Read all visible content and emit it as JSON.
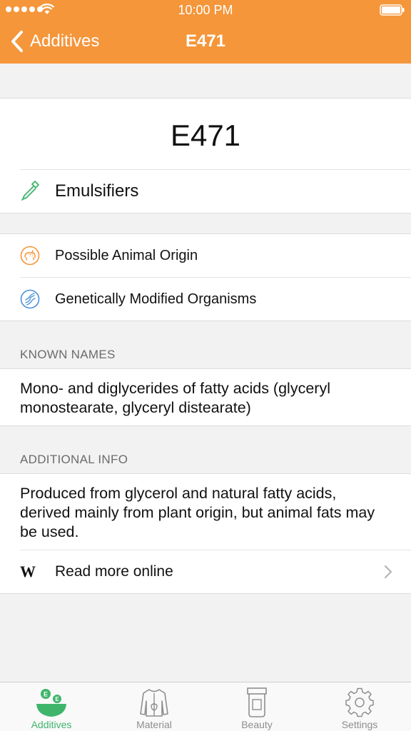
{
  "status_bar": {
    "time": "10:00 PM"
  },
  "nav": {
    "back_label": "Additives",
    "title": "E471"
  },
  "additive": {
    "code": "E471",
    "category": "Emulsifiers"
  },
  "properties": [
    {
      "label": "Possible Animal Origin",
      "icon": "animal-origin-icon",
      "color": "#f5963a"
    },
    {
      "label": "Genetically Modified Organisms",
      "icon": "dna-icon",
      "color": "#4a90d9"
    }
  ],
  "known_names": {
    "header": "KNOWN NAMES",
    "line1": "Mono- and diglycerides of fatty acids (glyceryl",
    "line2": "monostearate, glyceryl distearate)"
  },
  "additional_info": {
    "header": "ADDITIONAL INFO",
    "line1": "Produced from glycerol and natural fatty acids,",
    "line2": "derived mainly from plant origin, but animal fats may",
    "line3": "be used.",
    "read_more": "Read more online",
    "read_more_icon": "W"
  },
  "tabs": [
    {
      "label": "Additives",
      "icon": "additives-bowl-icon",
      "active": true
    },
    {
      "label": "Material",
      "icon": "jacket-icon",
      "active": false
    },
    {
      "label": "Beauty",
      "icon": "cream-tube-icon",
      "active": false
    },
    {
      "label": "Settings",
      "icon": "gear-icon",
      "active": false
    }
  ],
  "colors": {
    "accent": "#f5963a",
    "active_tab": "#3fb56b",
    "inactive_tab": "#8e8e8e"
  }
}
